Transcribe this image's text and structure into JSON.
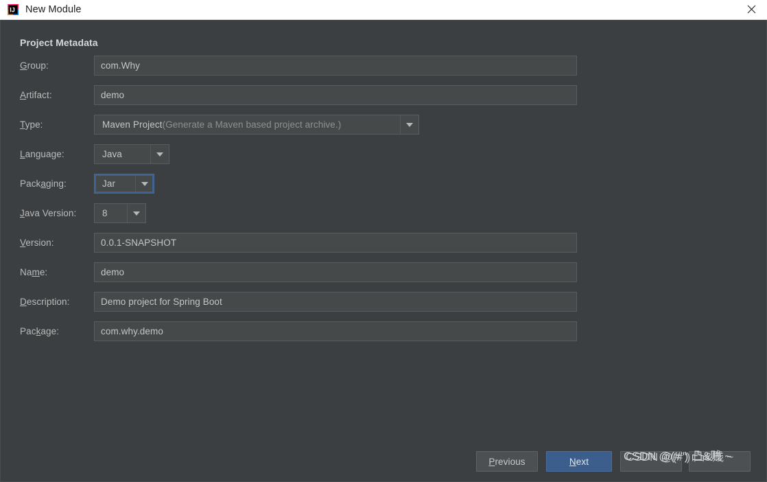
{
  "window": {
    "title": "New Module",
    "app_icon": "intellij-idea-icon",
    "close_icon": "close-icon",
    "background_color": "#3c3f41",
    "titlebar_color": "#ffffff"
  },
  "dialog": {
    "section_title": "Project Metadata",
    "fields": [
      {
        "key": "group",
        "label_before": "",
        "mnemonic": "G",
        "label_after": "roup:",
        "type": "text",
        "value": "com.Why"
      },
      {
        "key": "artifact",
        "label_before": "",
        "mnemonic": "A",
        "label_after": "rtifact:",
        "type": "text",
        "value": "demo"
      },
      {
        "key": "type",
        "label_before": "",
        "mnemonic": "T",
        "label_after": "ype:",
        "type": "combo",
        "value": "Maven Project",
        "value_hint": " (Generate a Maven based project archive.)"
      },
      {
        "key": "language",
        "label_before": "",
        "mnemonic": "L",
        "label_after": "anguage:",
        "type": "combo",
        "value": "Java"
      },
      {
        "key": "packaging",
        "label_before": "Pack",
        "mnemonic": "a",
        "label_after": "ging:",
        "type": "combo",
        "value": "Jar",
        "focused": true
      },
      {
        "key": "java_version",
        "label_before": "",
        "mnemonic": "J",
        "label_after": "ava Version:",
        "type": "combo",
        "value": "8"
      },
      {
        "key": "version",
        "label_before": "",
        "mnemonic": "V",
        "label_after": "ersion:",
        "type": "text",
        "value": "0.0.1-SNAPSHOT"
      },
      {
        "key": "name",
        "label_before": "Na",
        "mnemonic": "m",
        "label_after": "e:",
        "type": "text",
        "value": "demo"
      },
      {
        "key": "description",
        "label_before": "",
        "mnemonic": "D",
        "label_after": "escription:",
        "type": "text",
        "value": "Demo project for Spring Boot"
      },
      {
        "key": "package",
        "label_before": "Pac",
        "mnemonic": "k",
        "label_after": "age:",
        "type": "text",
        "value": "com.why.demo"
      }
    ],
    "buttons": {
      "previous_before": "",
      "previous_mnemonic": "P",
      "previous_after": "revious",
      "next_before": "",
      "next_mnemonic": "N",
      "next_after": "ext",
      "cancel": "",
      "help": ""
    },
    "accent_color": "#3c5e8c",
    "focus_color": "#3a6394"
  },
  "watermark": {
    "text": "CSDN @(#\") 凸&贱 ~",
    "text_overlay": "CSDN @(#\") 凸&贱 ~"
  }
}
